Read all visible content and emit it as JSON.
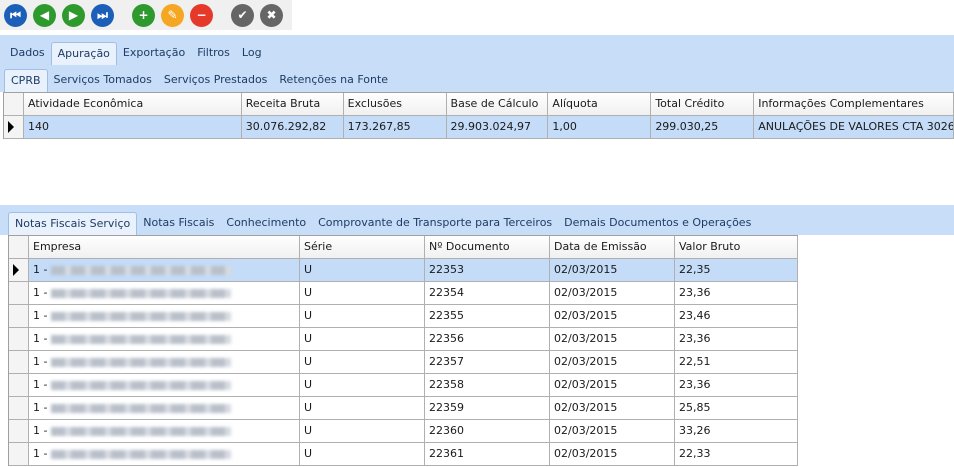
{
  "toolbar": {
    "buttons": [
      {
        "name": "first-record-icon",
        "color": "#1c5fb8",
        "glyph": "⏮"
      },
      {
        "name": "previous-record-icon",
        "color": "#2e9a2e",
        "glyph": "◀"
      },
      {
        "name": "next-record-icon",
        "color": "#2e9a2e",
        "glyph": "▶"
      },
      {
        "name": "last-record-icon",
        "color": "#1c5fb8",
        "glyph": "⏭"
      },
      {
        "name": "add-icon",
        "color": "#2e9a2e",
        "glyph": "+"
      },
      {
        "name": "edit-icon",
        "color": "#f5a623",
        "glyph": "✎"
      },
      {
        "name": "delete-icon",
        "color": "#e53a2a",
        "glyph": "−"
      },
      {
        "name": "confirm-icon",
        "color": "#666666",
        "glyph": "✔"
      },
      {
        "name": "cancel-icon",
        "color": "#666666",
        "glyph": "✖"
      }
    ]
  },
  "main_tabs": [
    "Dados",
    "Apuração",
    "Exportação",
    "Filtros",
    "Log"
  ],
  "sub_tabs": [
    "CPRB",
    "Serviços Tomados",
    "Serviços Prestados",
    "Retenções na Fonte"
  ],
  "cprb_grid": {
    "columns": [
      "Atividade Econômica",
      "Receita Bruta",
      "Exclusões",
      "Base de Cálculo",
      "Alíquota",
      "Total Crédito",
      "Informações Complementares"
    ],
    "rows": [
      [
        "140",
        "30.076.292,82",
        "173.267,85",
        "29.903.024,97",
        "1,00",
        "299.030,25",
        "ANULAÇÕES DE VALORES CTA 3026"
      ]
    ]
  },
  "doc_tabs": [
    "Notas Fiscais Serviço",
    "Notas Fiscais",
    "Conhecimento",
    "Comprovante de Transporte para Terceiros",
    "Demais Documentos e Operações"
  ],
  "notes_grid": {
    "columns": [
      "Empresa",
      "Série",
      "Nº Documento",
      "Data de Emissão",
      "Valor Bruto"
    ],
    "rows": [
      [
        "1 -",
        "U",
        "22353",
        "02/03/2015",
        "22,35"
      ],
      [
        "1 -",
        "U",
        "22354",
        "02/03/2015",
        "23,36"
      ],
      [
        "1 -",
        "U",
        "22355",
        "02/03/2015",
        "23,46"
      ],
      [
        "1 -",
        "U",
        "22356",
        "02/03/2015",
        "23,36"
      ],
      [
        "1 -",
        "U",
        "22357",
        "02/03/2015",
        "22,51"
      ],
      [
        "1 -",
        "U",
        "22358",
        "02/03/2015",
        "23,36"
      ],
      [
        "1 -",
        "U",
        "22359",
        "02/03/2015",
        "25,85"
      ],
      [
        "1 -",
        "U",
        "22360",
        "02/03/2015",
        "33,26"
      ],
      [
        "1 -",
        "U",
        "22361",
        "02/03/2015",
        "22,33"
      ]
    ]
  }
}
